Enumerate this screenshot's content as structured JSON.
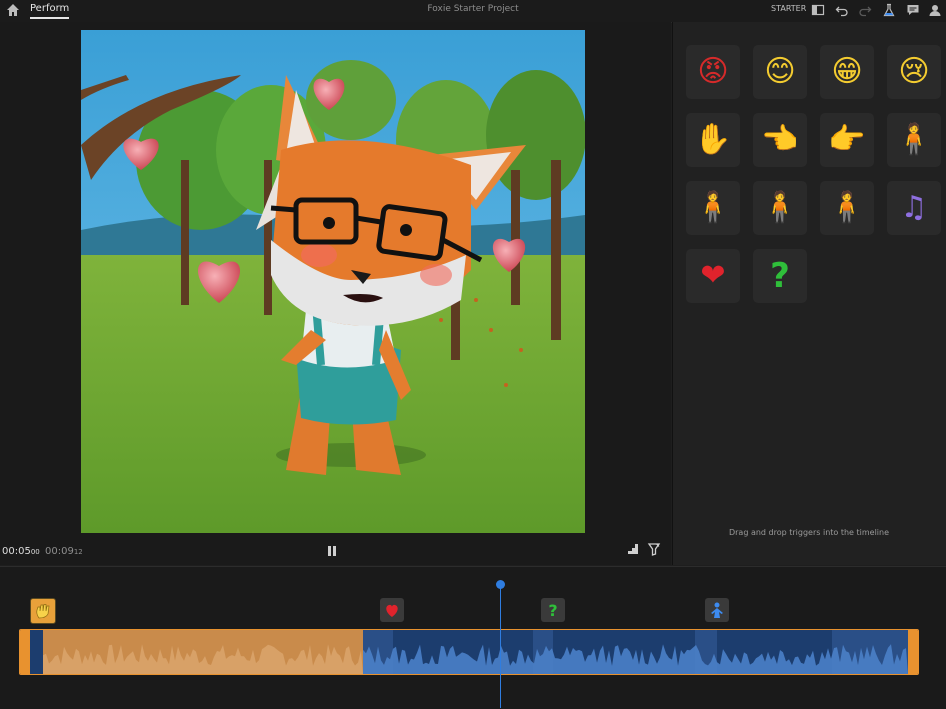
{
  "app": {
    "tab": "Perform",
    "project_title": "Foxie Starter Project",
    "badge": "STARTER"
  },
  "toolbar_icons": [
    "home-icon",
    "layout-icon",
    "undo-icon",
    "redo-icon",
    "flask-icon",
    "chat-icon",
    "profile-icon"
  ],
  "playback": {
    "current_time": "00:05",
    "current_frames": "00",
    "total_time": "00:09",
    "total_frames": "12"
  },
  "triggers": [
    {
      "name": "angry-face-icon",
      "glyph": "😡"
    },
    {
      "name": "blushing-face-icon",
      "glyph": "😊"
    },
    {
      "name": "smiling-face-icon",
      "glyph": "😁"
    },
    {
      "name": "sad-face-icon",
      "glyph": "😢"
    },
    {
      "name": "wave-hand-icon",
      "glyph": "✋"
    },
    {
      "name": "point-left-icon",
      "glyph": "👈"
    },
    {
      "name": "point-right-icon",
      "glyph": "👉"
    },
    {
      "name": "pose-arms-out-icon",
      "glyph": "🧍"
    },
    {
      "name": "pose-hands-hips-icon",
      "glyph": "🧍"
    },
    {
      "name": "pose-shrug-icon",
      "glyph": "🧍"
    },
    {
      "name": "pose-arms-down-icon",
      "glyph": "🧍"
    },
    {
      "name": "music-note-icon",
      "glyph": "♫"
    },
    {
      "name": "heart-icon",
      "glyph": "❤"
    },
    {
      "name": "question-mark-icon",
      "glyph": "?"
    }
  ],
  "panel_hint": "Drag and drop triggers into the timeline",
  "timeline_markers": [
    "wave-hand-icon",
    "heart-icon",
    "question-mark-icon",
    "pose-icon"
  ],
  "colors": {
    "accent": "#2f7de0",
    "clip_orange": "#e8922f",
    "clip_blue": "#1c3d6e"
  }
}
